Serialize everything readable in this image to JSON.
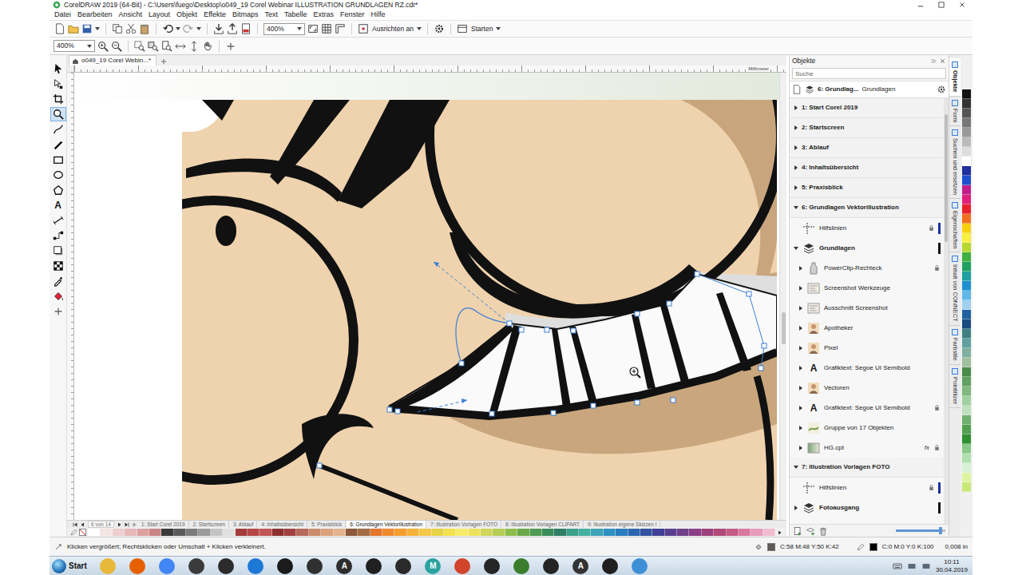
{
  "window": {
    "title": "CorelDRAW 2019 (64-Bit) - C:\\Users\\fuego\\Desktop\\o049_19 Corel Webinar ILLUSTRATION GRUNDLAGEN RZ.cdr*"
  },
  "menu": [
    "Datei",
    "Bearbeiten",
    "Ansicht",
    "Layout",
    "Objekt",
    "Effekte",
    "Bitmaps",
    "Text",
    "Tabelle",
    "Extras",
    "Fenster",
    "Hilfe"
  ],
  "toolbar": {
    "zoom": "400%",
    "snap": "Ausrichten an",
    "launch": "Starten"
  },
  "property_bar": {
    "zoom": "400%"
  },
  "document_tab": {
    "label": "o049_19 Corel Webin...*"
  },
  "ruler": {
    "unit": "Millimeter"
  },
  "toolbox": {
    "tools": [
      {
        "selected": false
      },
      {
        "selected": false
      },
      {
        "selected": false
      },
      {
        "selected": true
      },
      {
        "selected": false
      },
      {
        "selected": false
      },
      {
        "selected": false
      },
      {
        "selected": false
      },
      {
        "selected": false
      },
      {
        "selected": false,
        "glyph": "A"
      },
      {
        "selected": false
      },
      {
        "selected": false
      },
      {
        "selected": false
      },
      {
        "selected": false
      },
      {
        "selected": false
      },
      {
        "selected": false
      }
    ]
  },
  "docker": {
    "title": "Objekte",
    "search": {
      "placeholder": "Suche"
    },
    "current_page": "6: Grundlag...",
    "current_layer": "Grundlagen",
    "tree": [
      {
        "label": "1: Start Corel 2019",
        "kind": "page",
        "expanded": false
      },
      {
        "label": "2: Startscreen",
        "kind": "page",
        "expanded": false
      },
      {
        "label": "3: Ablauf",
        "kind": "page",
        "expanded": false
      },
      {
        "label": "4: Inhaltsübersicht",
        "kind": "page",
        "expanded": false
      },
      {
        "label": "5: Praxisblick",
        "kind": "page",
        "expanded": false
      },
      {
        "label": "6: Grundlagen Vektorillustration",
        "kind": "page",
        "expanded": true
      },
      {
        "label": "Hilfslinien",
        "kind": "guides",
        "locked": true,
        "color": "#1c2f9c"
      },
      {
        "label": "Grundlagen",
        "kind": "layer",
        "expanded": true,
        "locked": false,
        "color": "#111111"
      },
      {
        "label": "PowerClip-Rechteck",
        "kind": "powerclip",
        "expanded": false,
        "locked": true
      },
      {
        "label": "Screenshot Werkzeuge",
        "kind": "bitmap",
        "expanded": false,
        "locked": false
      },
      {
        "label": "Ausschnitt Screenshot",
        "kind": "bitmap",
        "expanded": false,
        "locked": false
      },
      {
        "label": "Apotheker",
        "kind": "group",
        "expanded": false,
        "locked": false
      },
      {
        "label": "Pixel",
        "kind": "group",
        "expanded": false,
        "locked": false
      },
      {
        "label": "Grafiktext: Segoe UI Semibold",
        "kind": "text",
        "glyph": "A",
        "expanded": false,
        "locked": false
      },
      {
        "label": "Vectoren",
        "kind": "group",
        "expanded": false,
        "locked": false
      },
      {
        "label": "Grafiktext: Segoe UI Semibold",
        "kind": "text",
        "glyph": "A",
        "expanded": false,
        "locked": true
      },
      {
        "label": "Gruppe von 17 Objekten",
        "kind": "curve",
        "expanded": false,
        "locked": false
      },
      {
        "label": "HG.cpt",
        "kind": "fill",
        "expanded": false,
        "locked": true,
        "effect": "fx"
      },
      {
        "label": "7: Illustration Vorlagen FOTO",
        "kind": "page",
        "expanded": true
      },
      {
        "label": "Hilfslinien",
        "kind": "guides",
        "locked": true,
        "color": "#1c2f9c"
      },
      {
        "label": "Fotoausgang",
        "kind": "layer",
        "expanded": false,
        "locked": false,
        "color": "#111111"
      }
    ],
    "thumbnail_slider": {
      "level": 0.9
    }
  },
  "docker_tabs": [
    {
      "label": "Objekte",
      "selected": true
    },
    {
      "label": "Form",
      "selected": false
    },
    {
      "label": "Suchen und ersetzen",
      "selected": false
    },
    {
      "label": "Eigenschaften",
      "selected": false
    },
    {
      "label": "Inhalt von CONNECT",
      "selected": false
    },
    {
      "label": "Farbstile",
      "selected": false
    },
    {
      "label": "Pointillizer",
      "selected": false
    }
  ],
  "palette": {
    "vertical": [
      "#111111",
      "#333333",
      "#555555",
      "#777777",
      "#999999",
      "#bbbbbb",
      "#dddddd",
      "#ffffff",
      "#2030a0",
      "#1f4fd0",
      "#c21f8c",
      "#e0207a",
      "#e8202a",
      "#f07020",
      "#f8d010",
      "#f8f040",
      "#b8d830",
      "#40b040",
      "#20a060",
      "#20a0a0",
      "#2090d0",
      "#60b8e8",
      "#a0d0f0",
      "#2060a0",
      "#1a4a80",
      "#408080",
      "#60a0a0",
      "#80b0a0",
      "#a0c0a0",
      "#4a8a4a",
      "#60a060",
      "#80b880",
      "#a0d0a0",
      "#c0e0c0",
      "#70b070",
      "#50a050",
      "#309030",
      "#88c888",
      "#b0e0b0",
      "#d8f0d8",
      "#e0f4a0",
      "#c8e878"
    ],
    "horizontal": [
      "#ffffff",
      "#f5e4e4",
      "#eecfcf",
      "#e6b8b8",
      "#dca0a0",
      "#c98585",
      "#3a3a3a",
      "#5a5a5a",
      "#7a7a7a",
      "#9a9a9a",
      "#c4c4c4",
      "#e0e0e0",
      "#a33b3b",
      "#b54747",
      "#c25555",
      "#8c2f2f",
      "#a04040",
      "#b86a5a",
      "#c98b6b",
      "#d9a27c",
      "#e3b48f",
      "#8c5a3a",
      "#a36b45",
      "#e2762c",
      "#ef8a2e",
      "#f59d2f",
      "#f6b23a",
      "#f3c94a",
      "#e6d246",
      "#f2e24f",
      "#f7ec6a",
      "#ece15a",
      "#cfd65a",
      "#b7cc55",
      "#8dbd4c",
      "#6aa84a",
      "#4f9a52",
      "#3a8c5a",
      "#2f7f66",
      "#3aa08a",
      "#45b0a0",
      "#3fa3b8",
      "#2f8fc0",
      "#2b7bbf",
      "#2d66b0",
      "#3552a0",
      "#3f3f95",
      "#5a3f8f",
      "#6f3f8a",
      "#8a3f86",
      "#9c3f7a",
      "#b04a7a",
      "#c45a86",
      "#d878a0",
      "#e79ab9",
      "#f0bcd0"
    ]
  },
  "page_nav": {
    "label": "6 von 14"
  },
  "page_tabs": [
    {
      "label": "1: Start Corel 2019",
      "selected": false
    },
    {
      "label": "2: Startscreen",
      "selected": false
    },
    {
      "label": "3: Ablauf",
      "selected": false
    },
    {
      "label": "4: Inhaltsübersicht",
      "selected": false
    },
    {
      "label": "5: Praxisblick",
      "selected": false
    },
    {
      "label": "6: Grundlagen Vektorillustration",
      "selected": true
    },
    {
      "label": "7: Illustration Vorlagen FOTO",
      "selected": false
    },
    {
      "label": "8: Illustration Vorlagen CLIPART",
      "selected": false
    },
    {
      "label": "9: Illustration eigene Skizzen I",
      "selected": false
    }
  ],
  "status_bar": {
    "hint": "Klicken vergrößert; Rechtsklicken oder Umschalt + Klicken verkleinert.",
    "fill": {
      "reading": "C:58 M:48 Y:50 K:42",
      "color": "#5e5856"
    },
    "outline": {
      "reading": "C:0 M:0 Y:0 K:100",
      "color": "#000000",
      "width": "0,008 in"
    }
  },
  "taskbar": {
    "start": "Start",
    "apps": [
      {
        "color": "#e8b839"
      },
      {
        "color": "#e66000"
      },
      {
        "color": "#4285f4"
      },
      {
        "color": "#3b3b3b"
      },
      {
        "color": "#2b2b2b"
      },
      {
        "color": "#1e78d6"
      },
      {
        "color": "#1b1b1b"
      },
      {
        "color": "#303030"
      },
      {
        "color": "#2d2d2d",
        "glyph": "A"
      },
      {
        "color": "#202020"
      },
      {
        "color": "#2a2a2a"
      },
      {
        "color": "#2ba3a0",
        "glyph": "M"
      },
      {
        "color": "#d3452b"
      },
      {
        "color": "#262626"
      },
      {
        "color": "#3a7d2c"
      },
      {
        "color": "#242424"
      },
      {
        "color": "#333333",
        "glyph": "A"
      },
      {
        "color": "#1f1f1f"
      },
      {
        "color": "#3f8fd6"
      }
    ],
    "time": "10:11",
    "date": "30.04.2019"
  }
}
